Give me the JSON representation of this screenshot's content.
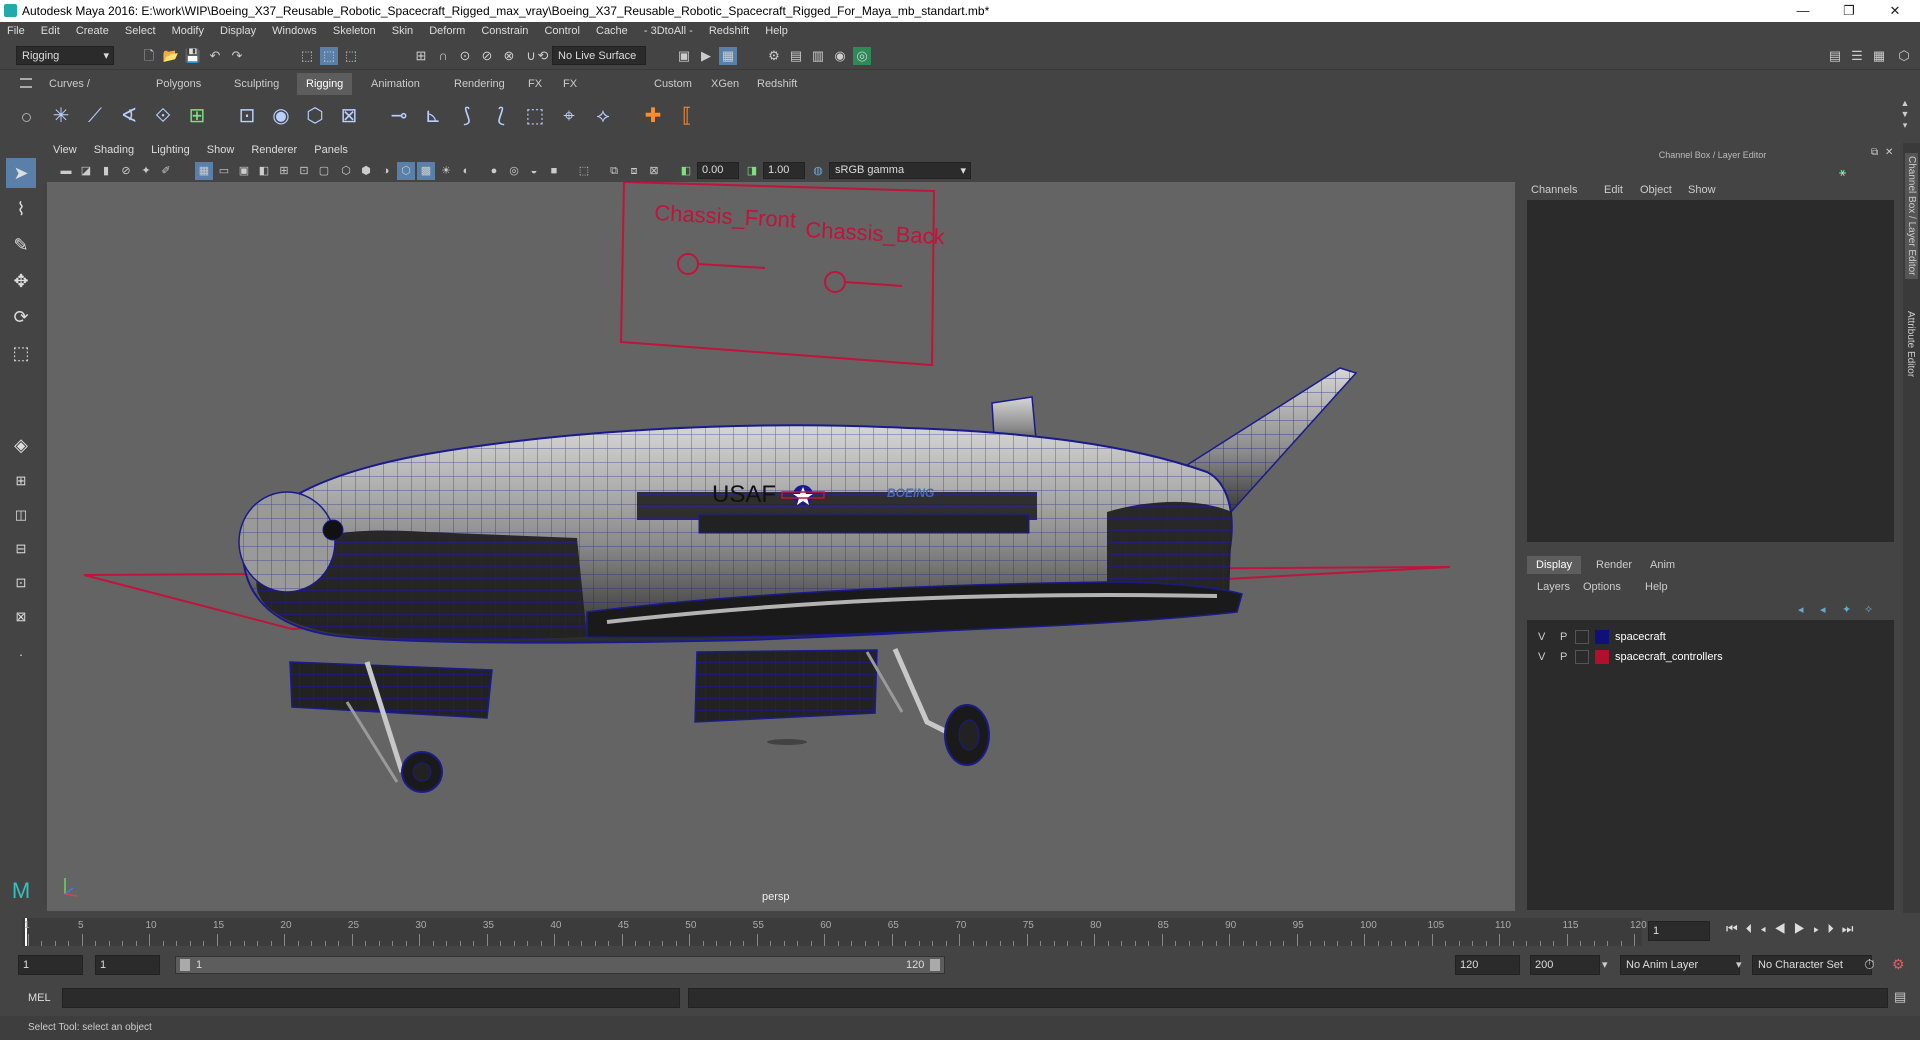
{
  "window": {
    "title": "Autodesk Maya 2016: E:\\work\\WIP\\Boeing_X37_Reusable_Robotic_Spacecraft_Rigged_max_vray\\Boeing_X37_Reusable_Robotic_Spacecraft_Rigged_For_Maya_mb_standart.mb*",
    "minimize": "—",
    "restore": "❐",
    "close": "✕"
  },
  "menubar": [
    "File",
    "Edit",
    "Create",
    "Select",
    "Modify",
    "Display",
    "Windows",
    "Skeleton",
    "Skin",
    "Deform",
    "Constrain",
    "Control",
    "Cache",
    "- 3DtoAll -",
    "Redshift",
    "Help"
  ],
  "statusline": {
    "menuset": "Rigging",
    "live_surface": "No Live Surface"
  },
  "shelf_tabs": [
    "Curves / Surfaces",
    "Polygons",
    "Sculpting",
    "Rigging",
    "Animation",
    "Rendering",
    "FX",
    "FX Caching",
    "Custom",
    "XGen",
    "Redshift"
  ],
  "active_shelf_tab": "Rigging",
  "viewport": {
    "menus": [
      "View",
      "Shading",
      "Lighting",
      "Show",
      "Renderer",
      "Panels"
    ],
    "exposure": "0.00",
    "gamma": "1.00",
    "color_space": "sRGB gamma",
    "camera_label": "persp",
    "controller_labels": [
      "Chassis_Front",
      "Chassis_Back"
    ],
    "decal_usaf": "USAF",
    "decal_boeing": "BOEING",
    "accent_wire": "#1a1a8c",
    "accent_controller": "#c0143c"
  },
  "channelbox": {
    "title": "Channel Box / Layer Editor",
    "menus": [
      "Channels",
      "Edit",
      "Object",
      "Show"
    ],
    "layer_tabs": [
      "Display",
      "Render",
      "Anim"
    ],
    "active_layer_tab": "Display",
    "layer_menus": [
      "Layers",
      "Options",
      "Help"
    ],
    "layers": [
      {
        "v": "V",
        "p": "P",
        "name": "spacecraft",
        "color": "#10107a"
      },
      {
        "v": "V",
        "p": "P",
        "name": "spacecraft_controllers",
        "color": "#b0102c"
      }
    ],
    "side_tabs": [
      "Channel Box / Layer Editor",
      "Attribute Editor"
    ]
  },
  "timeslider": {
    "ticks": [
      "1",
      "5",
      "10",
      "15",
      "20",
      "25",
      "30",
      "35",
      "40",
      "45",
      "50",
      "55",
      "60",
      "65",
      "70",
      "75",
      "80",
      "85",
      "90",
      "95",
      "100",
      "105",
      "110",
      "115",
      "120"
    ],
    "current_frame": "1"
  },
  "rangeslider": {
    "start": "1",
    "playback_start": "1",
    "range_start_label": "1",
    "range_end_label": "120",
    "playback_end": "120",
    "end": "200",
    "anim_layer": "No Anim Layer",
    "character_set": "No Character Set"
  },
  "cmdline": {
    "label": "MEL"
  },
  "helpline": {
    "text": "Select Tool: select an object"
  }
}
